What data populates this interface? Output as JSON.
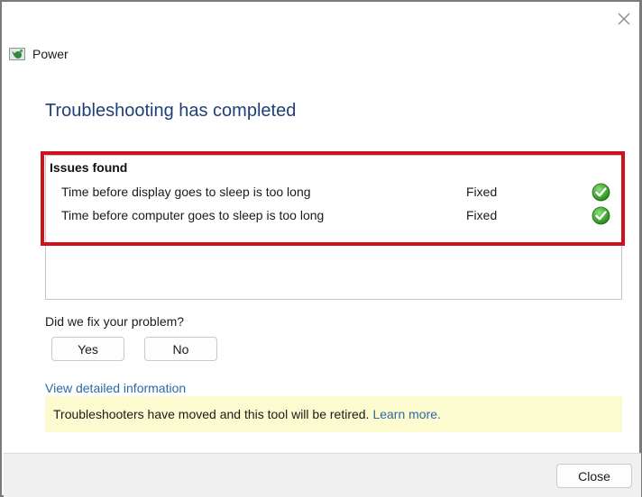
{
  "window": {
    "app_title": "Power",
    "app_icon": "power-troubleshooter-icon",
    "close_icon": "close-icon"
  },
  "main": {
    "heading": "Troubleshooting has completed",
    "issues": {
      "title": "Issues found",
      "items": [
        {
          "label": "Time before display goes to sleep is too long",
          "status": "Fixed",
          "status_icon": "green-check-icon"
        },
        {
          "label": "Time before computer goes to sleep is too long",
          "status": "Fixed",
          "status_icon": "green-check-icon"
        }
      ]
    },
    "feedback": {
      "question": "Did we fix your problem?",
      "yes_label": "Yes",
      "no_label": "No"
    },
    "detail_link": "View detailed information",
    "notice": {
      "text": "Troubleshooters have moved and this tool will be retired.",
      "link": "Learn more."
    }
  },
  "footer": {
    "close_label": "Close"
  },
  "colors": {
    "heading": "#1f3f78",
    "link": "#2b6aa3",
    "highlight_border": "#d0101a",
    "notice_bg": "#fcfbd0",
    "footer_bg": "#f0f0f0",
    "check_green": "#3a9d23"
  }
}
